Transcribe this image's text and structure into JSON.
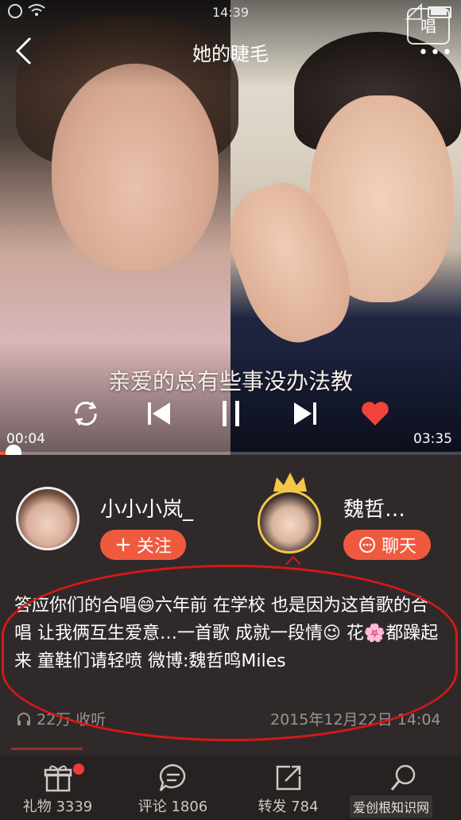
{
  "status_bar": {
    "time": "14:39"
  },
  "nav": {
    "title": "她的睫毛",
    "logo_text": "唱",
    "more": "•••"
  },
  "player": {
    "lyric": "亲爱的总有些事没办法教",
    "elapsed": "00:04",
    "duration": "03:35",
    "progress_fraction": 0.019
  },
  "users": {
    "left": {
      "name": "小小小岚_",
      "action": "关注"
    },
    "right": {
      "name": "魏哲…",
      "action": "聊天"
    }
  },
  "description": "答应你们的合唱😄六年前 在学校  也是因为这首歌的合唱 让我俩互生爱意…一首歌 成就一段情😉 花🌸都躁起来    童鞋们请轻喷    微博:魏哲鸣Miles",
  "stats": {
    "listens": "22万 收听",
    "date": "2015年12月22日 14:04"
  },
  "tabs": [
    {
      "label": "礼物 3339",
      "icon": "gift-icon"
    },
    {
      "label": "评论 1806",
      "icon": "comment-icon"
    },
    {
      "label": "转发 784",
      "icon": "share-icon"
    },
    {
      "label": "",
      "icon": "search-icon"
    }
  ],
  "watermark": "爱创根知识网",
  "colors": {
    "accent": "#ef5a3f",
    "annotation": "#d61818",
    "like": "#f0433a"
  }
}
